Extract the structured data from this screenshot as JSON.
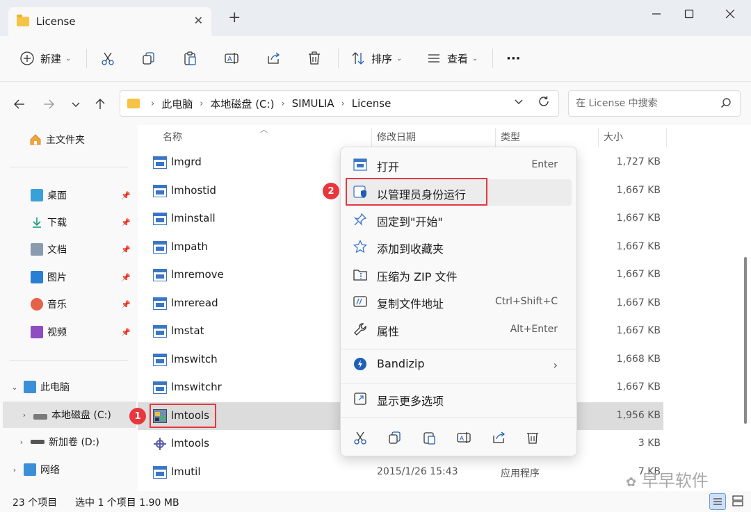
{
  "window": {
    "tab_title": "License",
    "tab_close": "✕",
    "new_tab": "+",
    "minimize": "—",
    "maximize": "☐",
    "close": "✕"
  },
  "toolbar": {
    "new_label": "新建",
    "sort_label": "排序",
    "view_label": "查看",
    "more_label": "···"
  },
  "address": {
    "crumbs": [
      "此电脑",
      "本地磁盘 (C:)",
      "SIMULIA",
      "License"
    ],
    "search_placeholder": "在 License 中搜索"
  },
  "sidebar": {
    "home": "主文件夹",
    "quick": [
      "桌面",
      "下载",
      "文档",
      "图片",
      "音乐",
      "视频"
    ],
    "this_pc": "此电脑",
    "drive_c": "本地磁盘 (C:)",
    "drive_d": "新加卷 (D:)",
    "network": "网络"
  },
  "columns": {
    "name": "名称",
    "date": "修改日期",
    "type": "类型",
    "size": "大小"
  },
  "files": [
    {
      "name": "lmgrd",
      "date": "",
      "type": "",
      "size": "1,727 KB"
    },
    {
      "name": "lmhostid",
      "date": "",
      "type": "",
      "size": "1,667 KB"
    },
    {
      "name": "lminstall",
      "date": "",
      "type": "",
      "size": "1,667 KB"
    },
    {
      "name": "lmpath",
      "date": "",
      "type": "",
      "size": "1,667 KB"
    },
    {
      "name": "lmremove",
      "date": "",
      "type": "",
      "size": "1,667 KB"
    },
    {
      "name": "lmreread",
      "date": "",
      "type": "",
      "size": "1,667 KB"
    },
    {
      "name": "lmstat",
      "date": "",
      "type": "",
      "size": "1,667 KB"
    },
    {
      "name": "lmswitch",
      "date": "",
      "type": "",
      "size": "1,668 KB"
    },
    {
      "name": "lmswitchr",
      "date": "",
      "type": "",
      "size": "1,667 KB"
    },
    {
      "name": "lmtools",
      "date": "",
      "type": "",
      "size": "1,956 KB"
    },
    {
      "name": "lmtools",
      "date": "",
      "type": "",
      "size": "3 KB"
    },
    {
      "name": "lmutil",
      "date": "2015/1/26 15:43",
      "type": "应用程序",
      "size": "7 KB"
    }
  ],
  "context_menu": {
    "items": [
      {
        "label": "打开",
        "shortcut": "Enter"
      },
      {
        "label": "以管理员身份运行",
        "shortcut": ""
      },
      {
        "label": "固定到\"开始\"",
        "shortcut": ""
      },
      {
        "label": "添加到收藏夹",
        "shortcut": ""
      },
      {
        "label": "压缩为 ZIP 文件",
        "shortcut": ""
      },
      {
        "label": "复制文件地址",
        "shortcut": "Ctrl+Shift+C"
      },
      {
        "label": "属性",
        "shortcut": "Alt+Enter"
      },
      {
        "label": "Bandizip",
        "shortcut": ""
      },
      {
        "label": "显示更多选项",
        "shortcut": ""
      }
    ]
  },
  "annotations": {
    "badge1": "1",
    "badge2": "2",
    "color": "#e8363d"
  },
  "status": {
    "count": "23 个项目",
    "selection": "选中 1 个项目  1.90 MB"
  },
  "watermark": "早早软件"
}
